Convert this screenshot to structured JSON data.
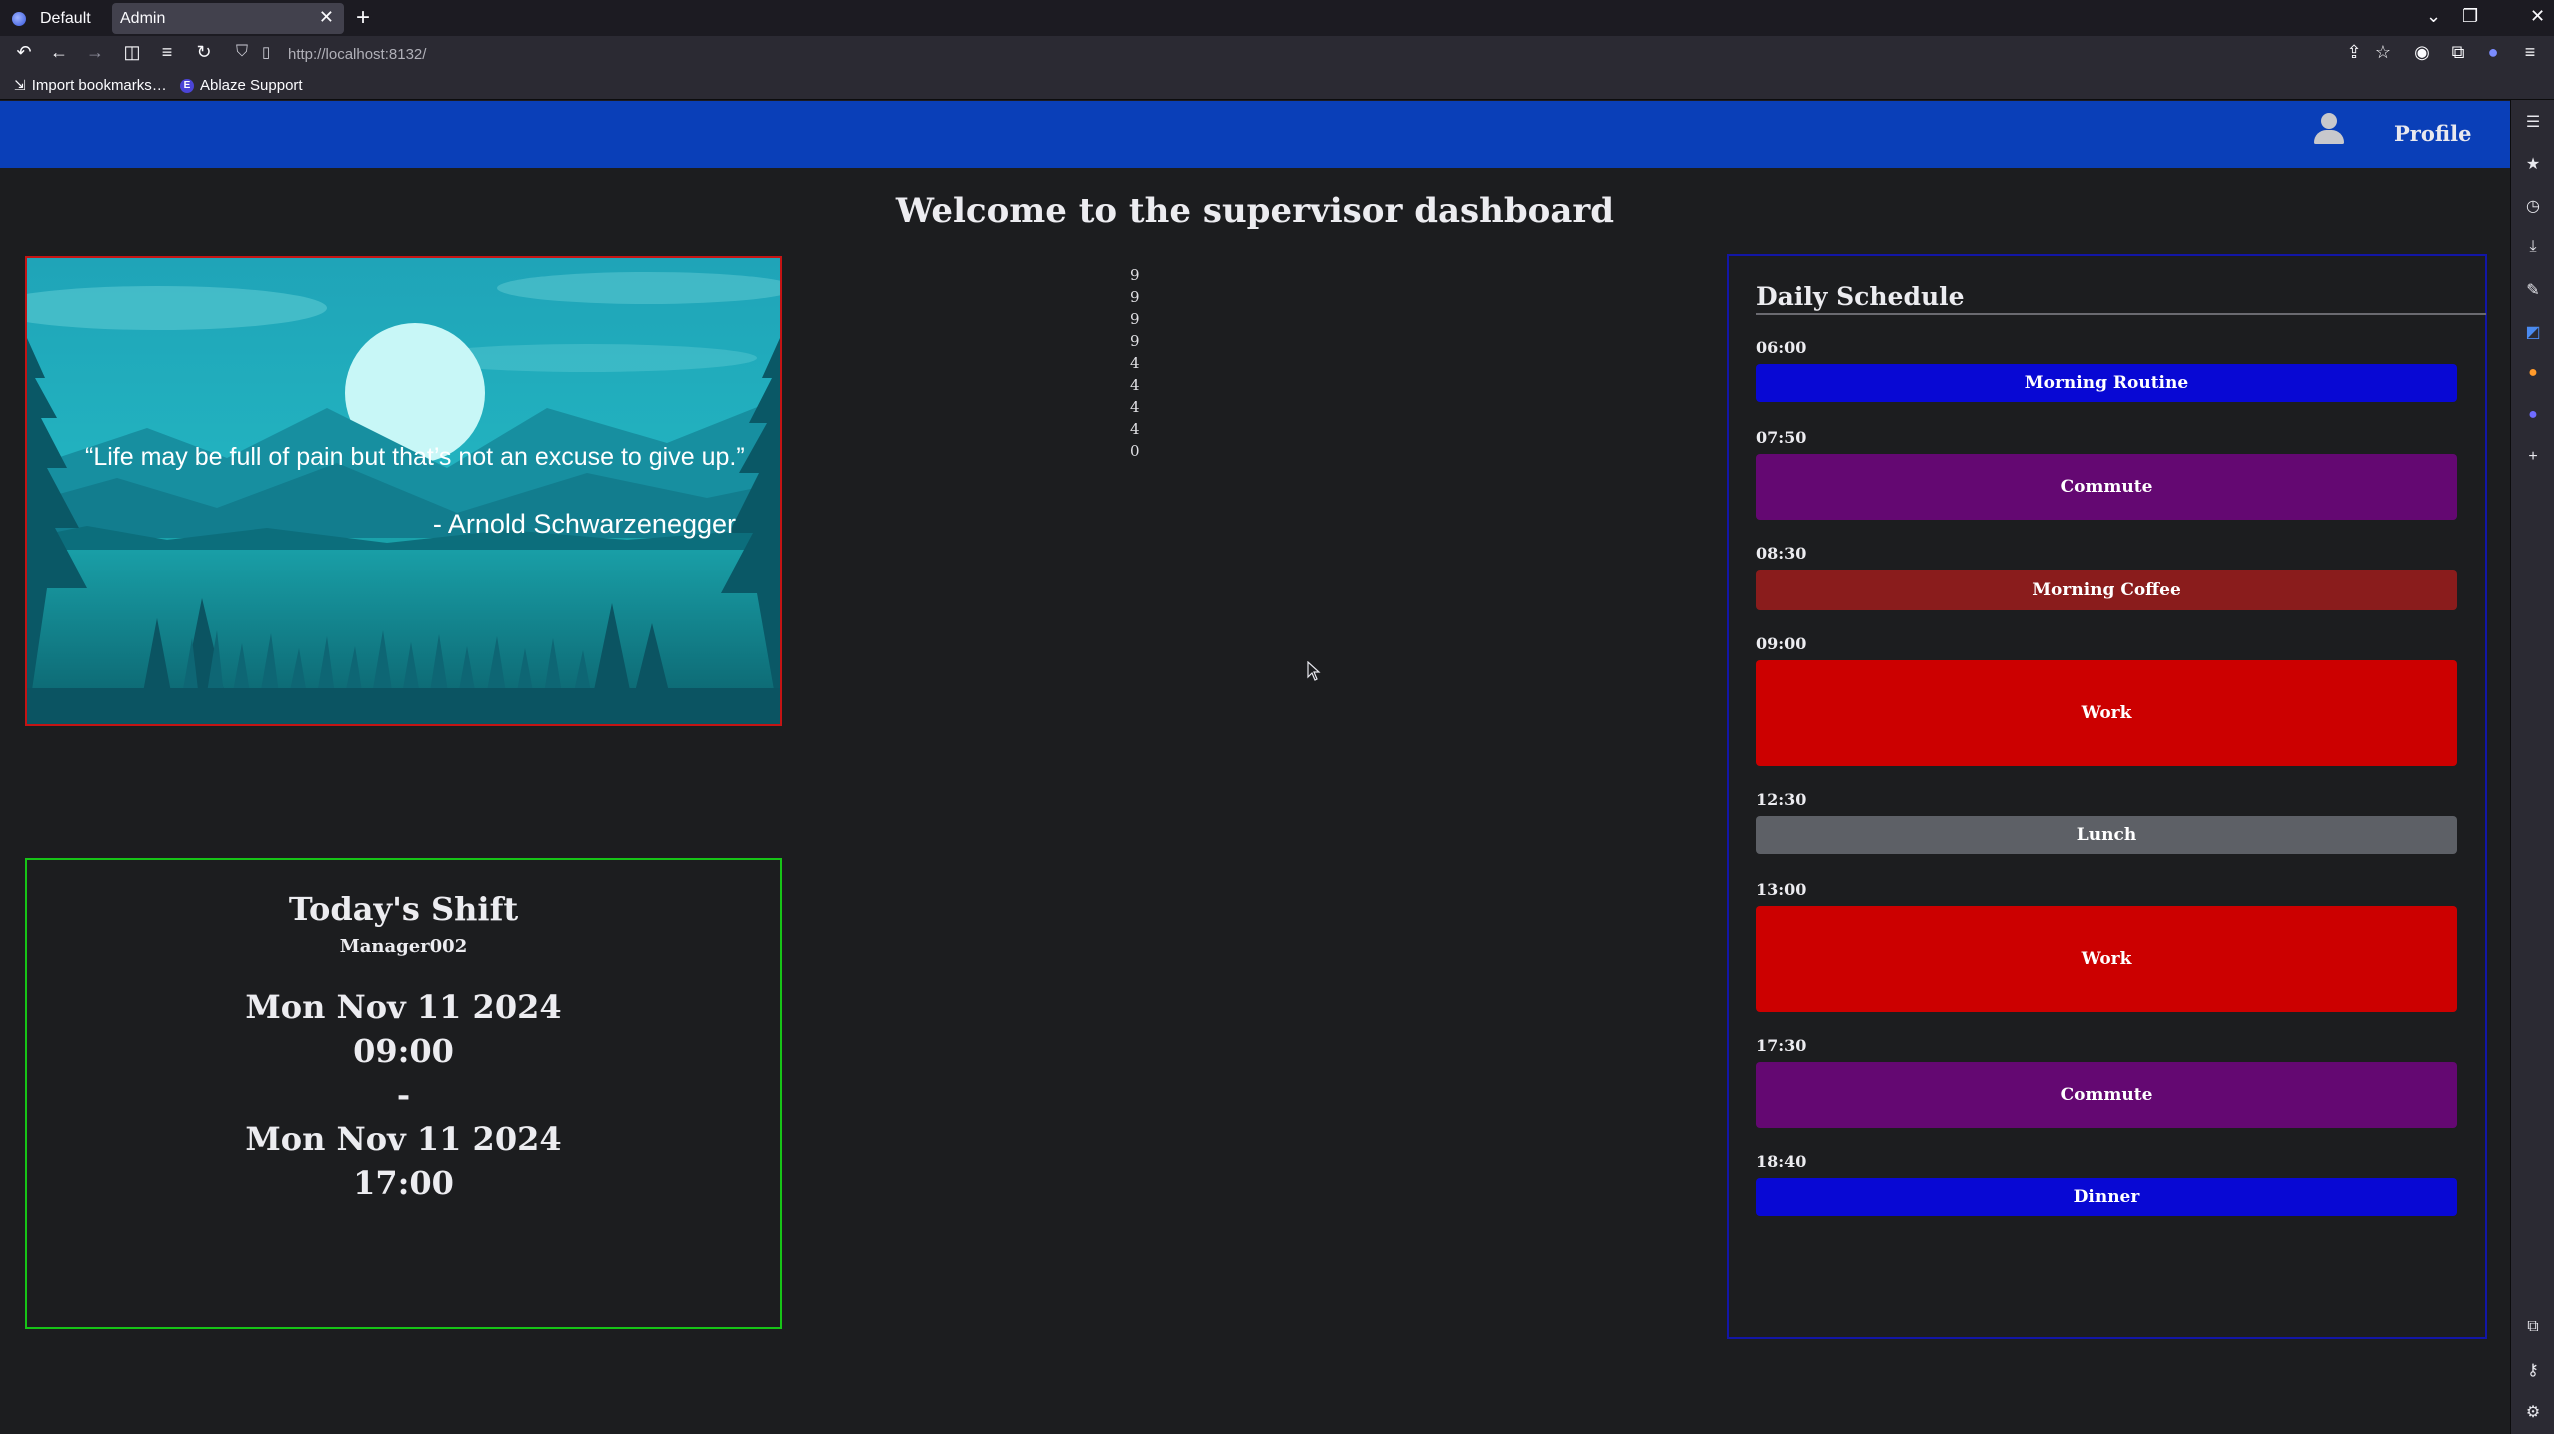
{
  "browser": {
    "tabs": [
      {
        "label": "Default",
        "active": false
      },
      {
        "label": "Admin",
        "active": true
      }
    ],
    "url": "http://localhost:8132/",
    "bookmarks": [
      {
        "label": "Import bookmarks…"
      },
      {
        "label": "Ablaze Support"
      }
    ]
  },
  "header": {
    "profile_label": "Profile"
  },
  "page": {
    "title": "Welcome to the supervisor dashboard"
  },
  "quote": {
    "text": "“Life may be full of pain but that’s not an excuse to give up.”",
    "author": "- Arnold Schwarzenegger",
    "border_color": "#c41414"
  },
  "counter": {
    "values": [
      "9",
      "9",
      "9",
      "9",
      "4",
      "4",
      "4",
      "4",
      "0"
    ]
  },
  "shift": {
    "title": "Today's Shift",
    "user": "Manager002",
    "start_date": "Mon Nov 11 2024",
    "start_time": "09:00",
    "separator": "-",
    "end_date": "Mon Nov 11 2024",
    "end_time": "17:00",
    "border_color": "#17c417"
  },
  "schedule": {
    "title": "Daily Schedule",
    "items": [
      {
        "time": "06:00",
        "label": "Morning Routine",
        "color": "#0808d4"
      },
      {
        "time": "07:50",
        "label": "Commute",
        "color": "#640872"
      },
      {
        "time": "08:30",
        "label": "Morning Coffee",
        "color": "#8a1c1c"
      },
      {
        "time": "09:00",
        "label": "Work",
        "color": "#cc0000"
      },
      {
        "time": "12:30",
        "label": "Lunch",
        "color": "#5d6066"
      },
      {
        "time": "13:00",
        "label": "Work",
        "color": "#cc0000"
      },
      {
        "time": "17:30",
        "label": "Commute",
        "color": "#640872"
      },
      {
        "time": "18:40",
        "label": "Dinner",
        "color": "#0808d4"
      }
    ]
  },
  "colors": {
    "nav_bar": "#0a3fb8",
    "page_background": "#1c1d1f",
    "schedule_border": "#1216a6"
  }
}
